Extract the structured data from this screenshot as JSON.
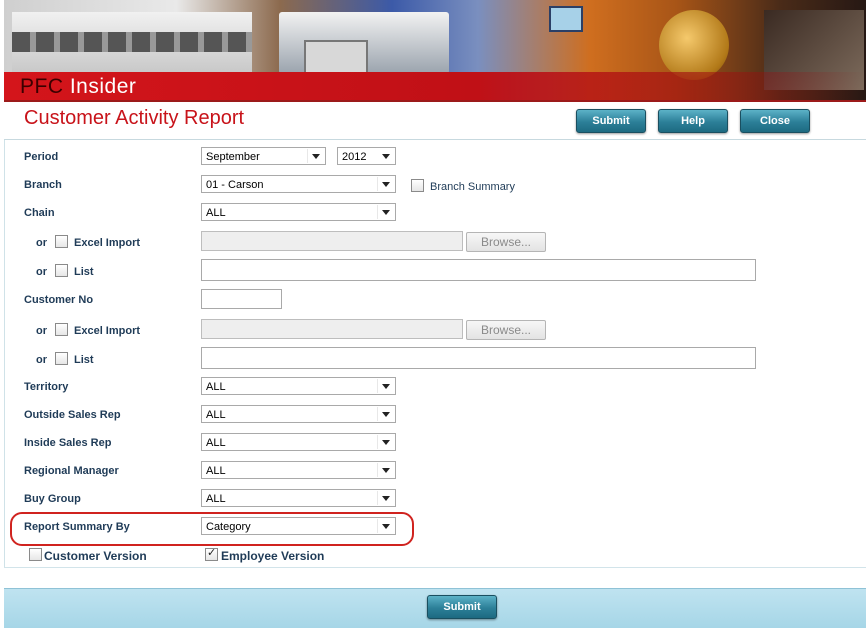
{
  "header": {
    "brand_prefix": "PFC",
    "brand_suffix": " Insider",
    "page_title": "Customer Activity Report",
    "buttons": {
      "submit": "Submit",
      "help": "Help",
      "close": "Close"
    }
  },
  "form": {
    "period": {
      "label": "Period",
      "month": "September",
      "year": "2012"
    },
    "branch": {
      "label": "Branch",
      "value": "01 - Carson",
      "summary_label": "Branch Summary",
      "summary_checked": false
    },
    "chain": {
      "label": "Chain",
      "value": "ALL",
      "or": "or",
      "excel_label": "Excel Import",
      "excel_checked": false,
      "browse": "Browse...",
      "list_label": "List",
      "list_checked": false,
      "list_value": ""
    },
    "customer_no": {
      "label": "Customer No",
      "value": "",
      "or": "or",
      "excel_label": "Excel Import",
      "excel_checked": false,
      "browse": "Browse...",
      "list_label": "List",
      "list_checked": false,
      "list_value": ""
    },
    "territory": {
      "label": "Territory",
      "value": "ALL"
    },
    "outside_sales_rep": {
      "label": "Outside Sales Rep",
      "value": "ALL"
    },
    "inside_sales_rep": {
      "label": "Inside Sales Rep",
      "value": "ALL"
    },
    "regional_manager": {
      "label": "Regional Manager",
      "value": "ALL"
    },
    "buy_group": {
      "label": "Buy Group",
      "value": "ALL"
    },
    "report_summary_by": {
      "label": "Report Summary By",
      "value": "Category"
    },
    "customer_version": {
      "label": "Customer Version",
      "checked": false
    },
    "employee_version": {
      "label": "Employee Version",
      "checked": true
    }
  },
  "footer": {
    "submit": "Submit"
  },
  "colors": {
    "title_red": "#c8131a",
    "button_teal": "#2c7f98",
    "label_navy": "#1f3b57",
    "highlight_red": "#d0231f"
  }
}
